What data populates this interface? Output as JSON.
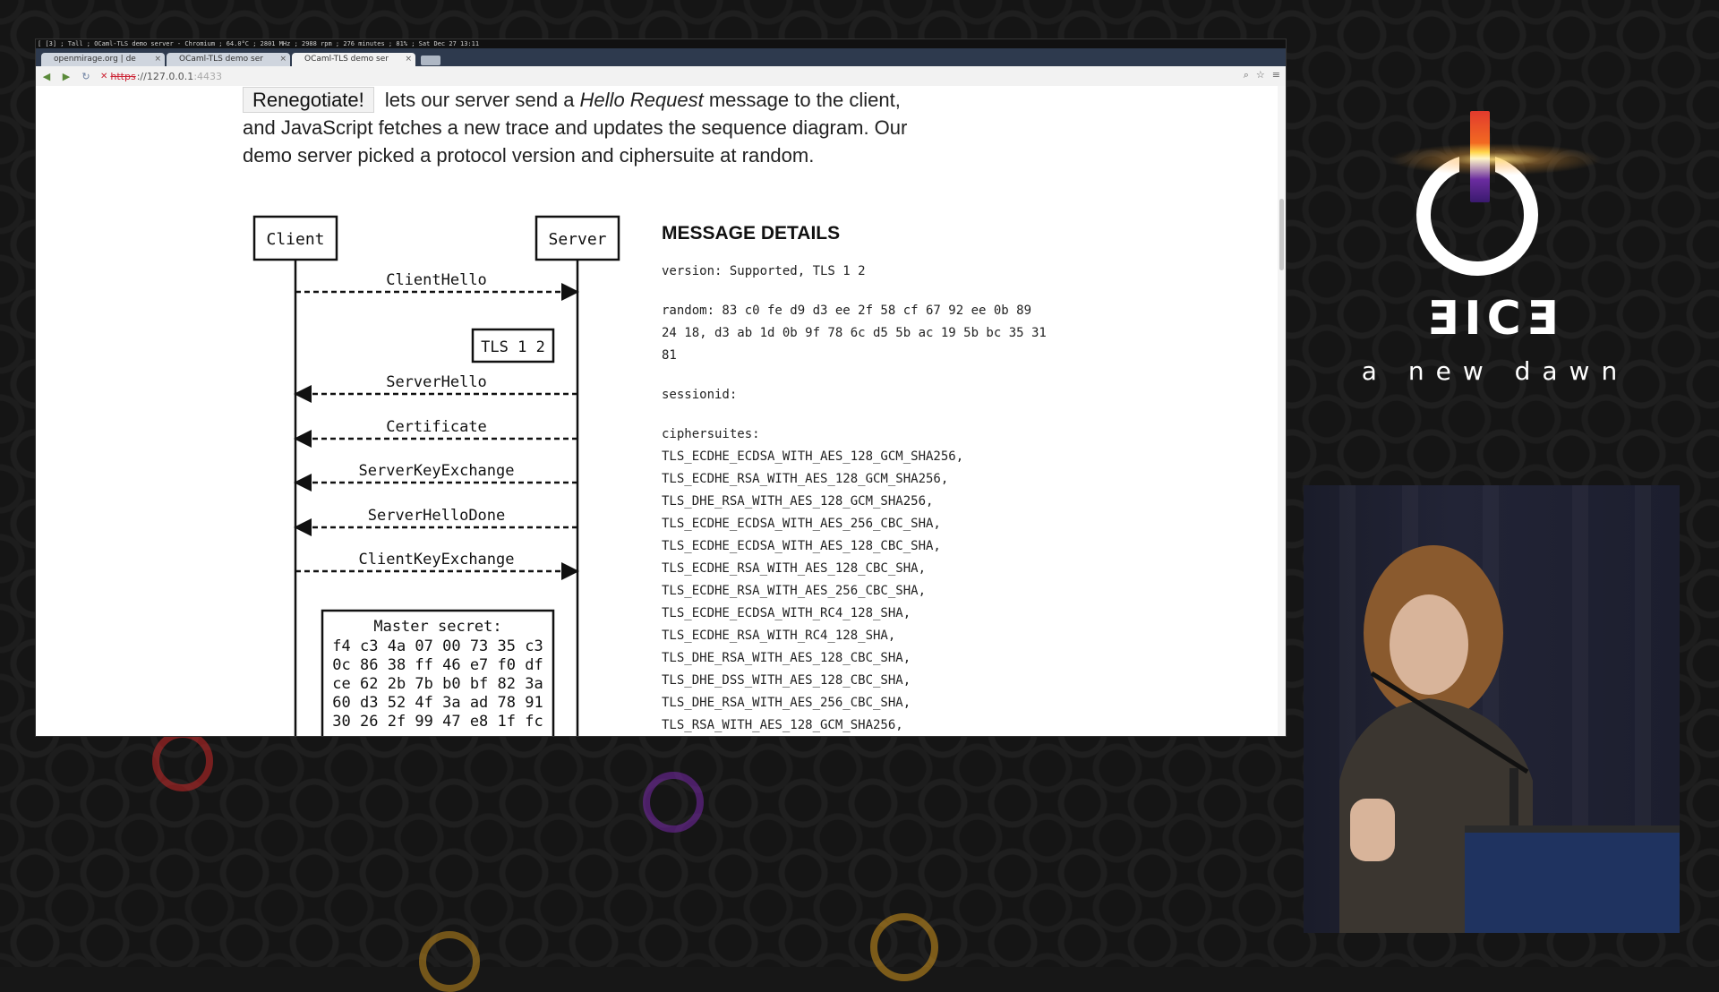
{
  "system_bar": {
    "status": "[ [3] ; Tall ; OCaml-TLS demo server - Chromium ; 64.0°C ; 2801 MHz ; 2988 rpm ; 276 minutes ; 81% ; Sat Dec 27 13:11"
  },
  "browser": {
    "tabs": [
      {
        "label": "openmirage.org | de"
      },
      {
        "label": "OCaml-TLS demo ser"
      },
      {
        "label": "OCaml-TLS demo ser"
      }
    ],
    "tab_close": "×",
    "url": {
      "scheme": "https",
      "rest": "://127.0.0.1",
      "port": ":4433"
    }
  },
  "page": {
    "renegotiate_label": "Renegotiate!",
    "intro_part1": " lets our server send a ",
    "intro_em": "Hello Request",
    "intro_part2": " message to the client, and JavaScript fetches a new trace and updates the sequence diagram. Our demo server picked a protocol version and ciphersuite at random."
  },
  "diagram": {
    "client_label": "Client",
    "server_label": "Server",
    "version_box": "TLS 1 2",
    "messages": [
      {
        "label": "ClientHello",
        "direction": "to-server"
      },
      {
        "label": "ServerHello",
        "direction": "to-client"
      },
      {
        "label": "Certificate",
        "direction": "to-client"
      },
      {
        "label": "ServerKeyExchange",
        "direction": "to-client"
      },
      {
        "label": "ServerHelloDone",
        "direction": "to-client"
      },
      {
        "label": "ClientKeyExchange",
        "direction": "to-server"
      }
    ],
    "master_secret_title": "Master secret:",
    "master_secret_lines": [
      "f4 c3 4a 07 00 73 35 c3",
      "0c 86 38 ff 46 e7 f0 df",
      "ce 62 2b 7b b0 bf 82 3a",
      "60 d3 52 4f 3a ad 78 91",
      "30 26 2f 99 47 e8 1f fc"
    ]
  },
  "details": {
    "title": "MESSAGE DETAILS",
    "version": "version: Supported, TLS 1 2",
    "random_lines": [
      "random: 83 c0 fe d9 d3 ee 2f 58 cf 67 92 ee 0b 89",
      "24 18, d3 ab 1d 0b 9f 78 6c d5 5b ac 19 5b bc 35 31",
      "81"
    ],
    "sessionid": "sessionid:",
    "ciphersuites_label": "ciphersuites:",
    "ciphersuites": [
      "TLS_ECDHE_ECDSA_WITH_AES_128_GCM_SHA256,",
      "TLS_ECDHE_RSA_WITH_AES_128_GCM_SHA256,",
      "TLS_DHE_RSA_WITH_AES_128_GCM_SHA256,",
      "TLS_ECDHE_ECDSA_WITH_AES_256_CBC_SHA,",
      "TLS_ECDHE_ECDSA_WITH_AES_128_CBC_SHA,",
      "TLS_ECDHE_RSA_WITH_AES_128_CBC_SHA,",
      "TLS_ECDHE_RSA_WITH_AES_256_CBC_SHA,",
      "TLS_ECDHE_ECDSA_WITH_RC4_128_SHA,",
      "TLS_ECDHE_RSA_WITH_RC4_128_SHA,",
      "TLS_DHE_RSA_WITH_AES_128_CBC_SHA,",
      "TLS_DHE_DSS_WITH_AES_128_CBC_SHA,",
      "TLS_DHE_RSA_WITH_AES_256_CBC_SHA,",
      "TLS_RSA_WITH_AES_128_GCM_SHA256,"
    ]
  },
  "conference": {
    "logo_word": "ƎICƎ",
    "tagline": "a new dawn"
  },
  "colors": {
    "background": "#151515",
    "accent_red": "#e23a2d",
    "accent_purple": "#6b2ca0",
    "accent_gold": "#ffb02e"
  }
}
